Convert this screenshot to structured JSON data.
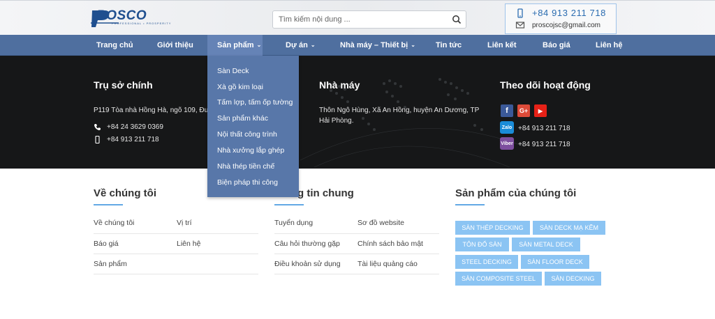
{
  "header": {
    "logo_text": "ROSCO",
    "logo_sub": "PROFESSIONAL • PROSPERITY",
    "search_placeholder": "Tìm kiếm nội dung ...",
    "phone": "+84 913 211 718",
    "email": "proscojsc@gmail.com"
  },
  "nav": {
    "items": [
      {
        "label": "Trang chủ"
      },
      {
        "label": "Giới thiệu"
      },
      {
        "label": "Sản phẩm"
      },
      {
        "label": "Dự án"
      },
      {
        "label": "Nhà máy – Thiết bị"
      },
      {
        "label": "Tin tức"
      },
      {
        "label": "Liên kết"
      },
      {
        "label": "Báo giá"
      },
      {
        "label": "Liên hệ"
      }
    ]
  },
  "dropdown": {
    "items": [
      "Sàn Deck",
      "Xà gồ kim loại",
      "Tấm lợp, tấm ốp tường",
      "Sản phẩm khác",
      "Nội thất công trình",
      "Nhà xưởng lắp ghép",
      "Nhà thép tiền chế",
      "Biện pháp thi công"
    ]
  },
  "footer_top": {
    "hq": {
      "title": "Trụ sở chính",
      "address": "P119 Tòa nhà Hồng Hà, ngõ 109, Đư",
      "tel": "+84 24 3629 0369",
      "mobile": "+84 913 211 718"
    },
    "factory": {
      "title": "Nhà máy",
      "address": "Thôn Ngô Hùng, Xã An Hồng, huyện An Dương, TP Hải Phòng."
    },
    "follow": {
      "title": "Theo dõi hoạt động",
      "social": [
        "f",
        "G+",
        "▶"
      ],
      "zalo_label": "Zalo",
      "zalo_phone": "+84 913 211 718",
      "viber_label": "Viber",
      "viber_phone": "+84 913 211 718"
    }
  },
  "about": {
    "title": "Về chúng tôi",
    "links": [
      "Về chúng tôi",
      "Vị trí",
      "Báo giá",
      "Liên hệ",
      "Sản phẩm"
    ]
  },
  "info": {
    "title_visible": "g tin chung",
    "links": [
      "Tuyển dụng",
      "Sơ đồ website",
      "Câu hỏi thường gặp",
      "Chính sách bảo mật",
      "Điều khoản sử dụng",
      "Tài liệu quảng cáo"
    ]
  },
  "products": {
    "title": "Sản phẩm của chúng tôi",
    "tags": [
      "SÀN THÉP DECKING",
      "SÀN DECK MẠ KẼM",
      "TÔN ĐỔ SÀN",
      "SÀN METAL DECK",
      "STEEL DECKING",
      "SÀN FLOOR DECK",
      "SÀN COMPOSITE STEEL",
      "SÀN DECKING"
    ]
  },
  "colors": {
    "nav_bg": "#4f6f9f",
    "dropdown_bg": "#5877a9",
    "tag_bg": "#8bc4f3",
    "accent_line": "#62a8e5",
    "dark_bg": "#161718"
  }
}
